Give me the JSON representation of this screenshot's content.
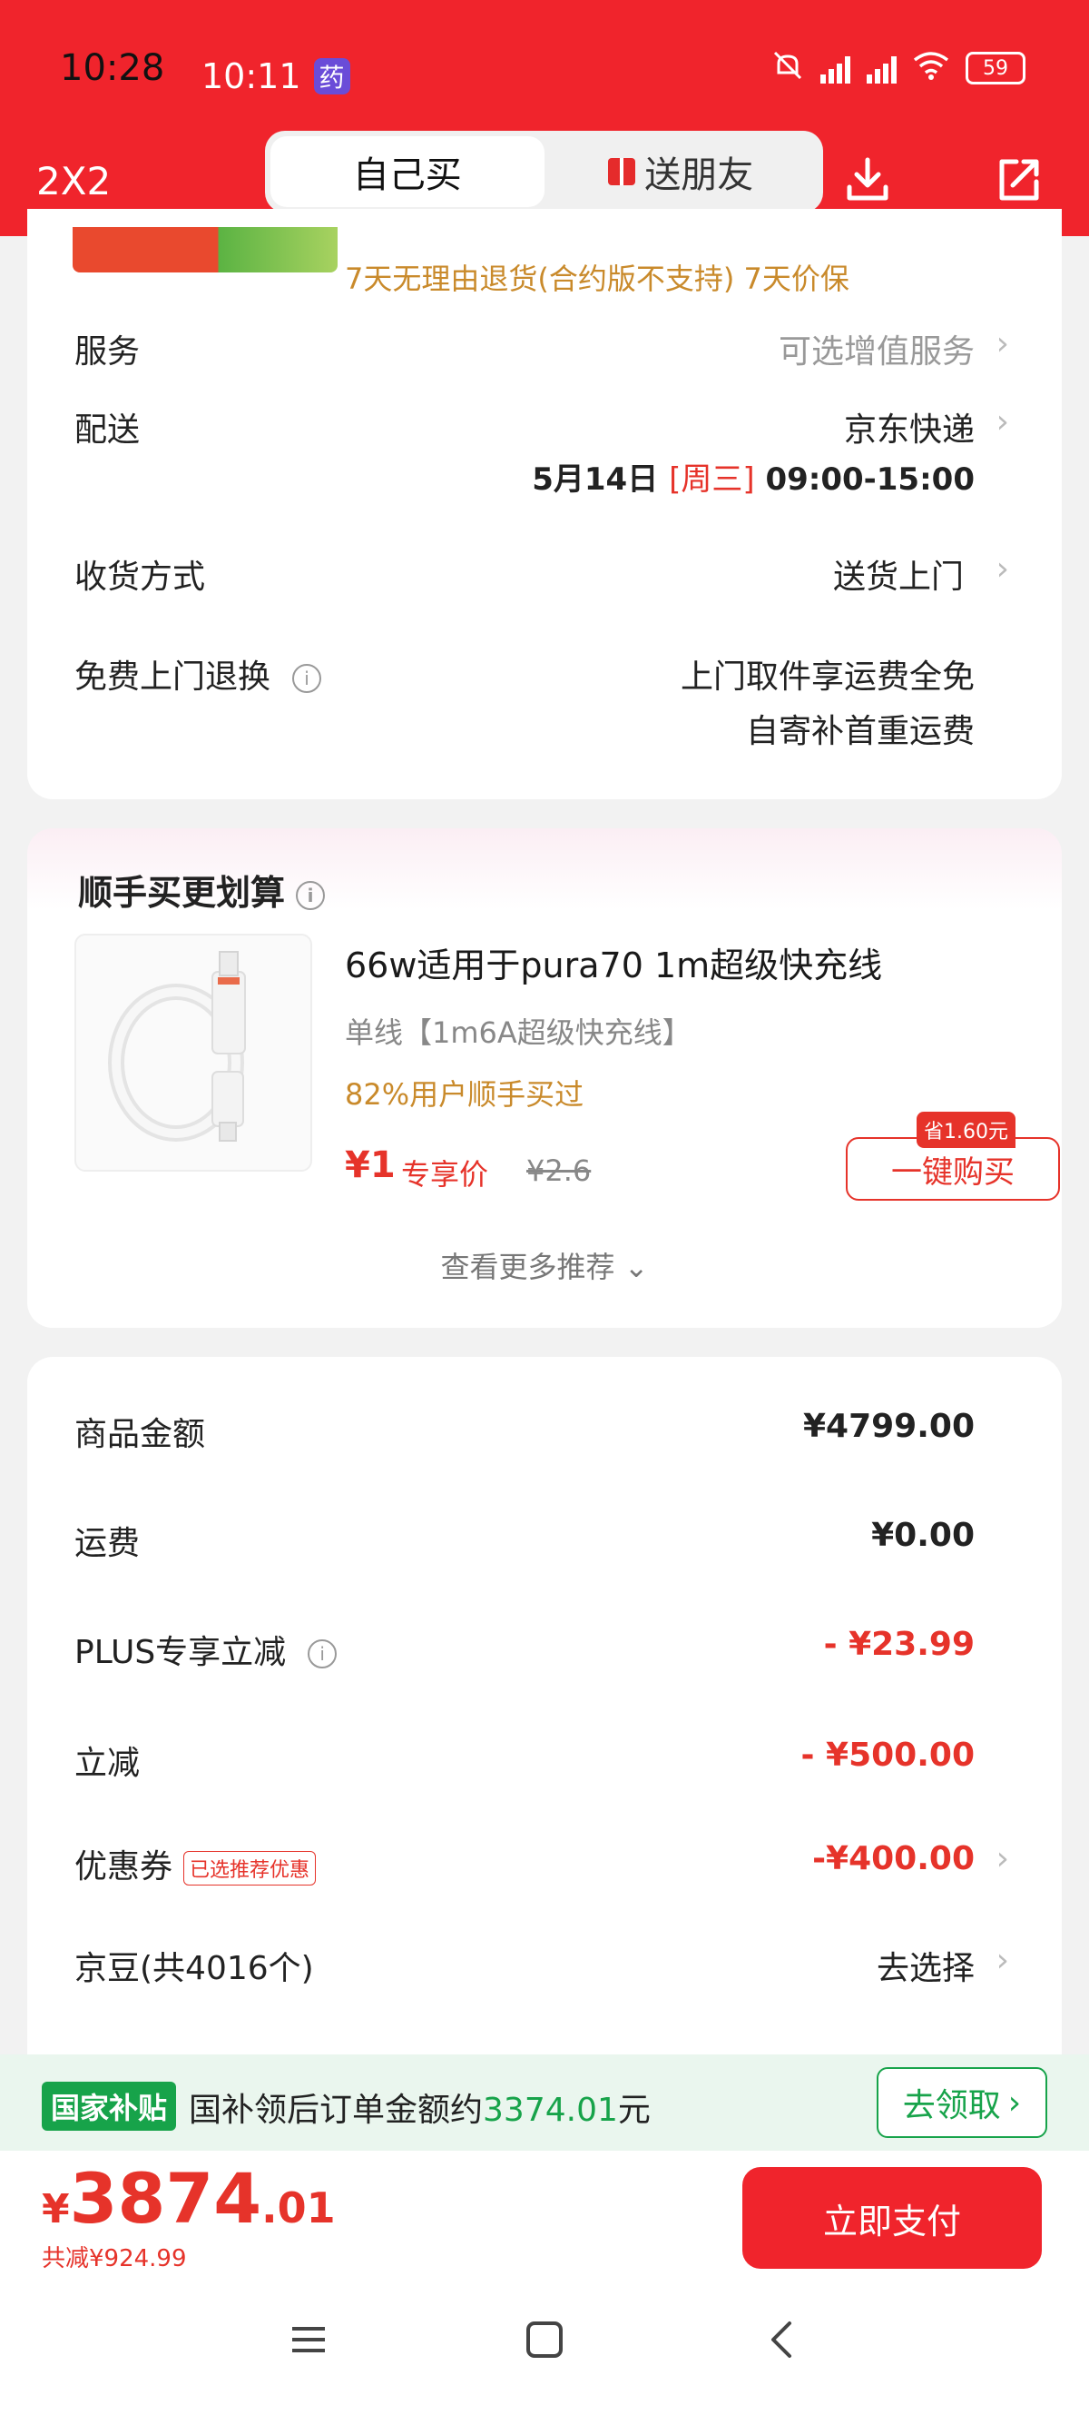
{
  "status_bar": {
    "time_overlay": "10:28",
    "time": "10:11",
    "badge": "药",
    "battery": "59"
  },
  "header": {
    "close_label": "2X2",
    "tab_self": "自己买",
    "tab_gift": "送朋友"
  },
  "shipping": {
    "policy": "7天无理由退货(合约版不支持) 7天价保",
    "service_label": "服务",
    "service_value": "可选增值服务",
    "delivery_label": "配送",
    "delivery_value": "京东快递",
    "date_prefix": "5月14日",
    "date_weekday": "[周三]",
    "date_time": "09:00-15:00",
    "receive_label": "收货方式",
    "receive_value": "送货上门",
    "return_label": "免费上门退换",
    "return_line1": "上门取件享运费全免",
    "return_line2": "自寄补首重运费"
  },
  "addon": {
    "title": "顺手买更划算",
    "name": "66w适用于pura70 1m超级快充线",
    "spec": "单线【1m6A超级快充线】",
    "hot": "82%用户顺手买过",
    "price": "¥1",
    "price_tag": "专享价",
    "orig_price": "¥2.6",
    "save_tag": "省1.60元",
    "buy_label": "一键购买",
    "more": "查看更多推荐"
  },
  "amounts": {
    "goods_label": "商品金额",
    "goods_value": "¥4799.00",
    "freight_label": "运费",
    "freight_value": "¥0.00",
    "plus_label": "PLUS专享立减",
    "plus_value": "- ¥23.99",
    "discount_label": "立减",
    "discount_value": "- ¥500.00",
    "coupon_label": "优惠券",
    "coupon_tag": "已选推荐优惠",
    "coupon_value": "-¥400.00",
    "bean_label": "京豆(共4016个)",
    "bean_value": "去选择"
  },
  "subsidy": {
    "badge": "国家补贴",
    "text_prefix": "国补领后订单金额约",
    "amount": "3374.01",
    "text_suffix": "元",
    "button": "去领取"
  },
  "paybar": {
    "yen": "¥",
    "total_int": "3874",
    "total_dec": ".01",
    "saved": "共减¥924.99",
    "pay_label": "立即支付"
  },
  "colors": {
    "brand_red": "#f0242c",
    "price_red": "#e6332a",
    "gold": "#c98a2b",
    "green": "#17a34a"
  }
}
